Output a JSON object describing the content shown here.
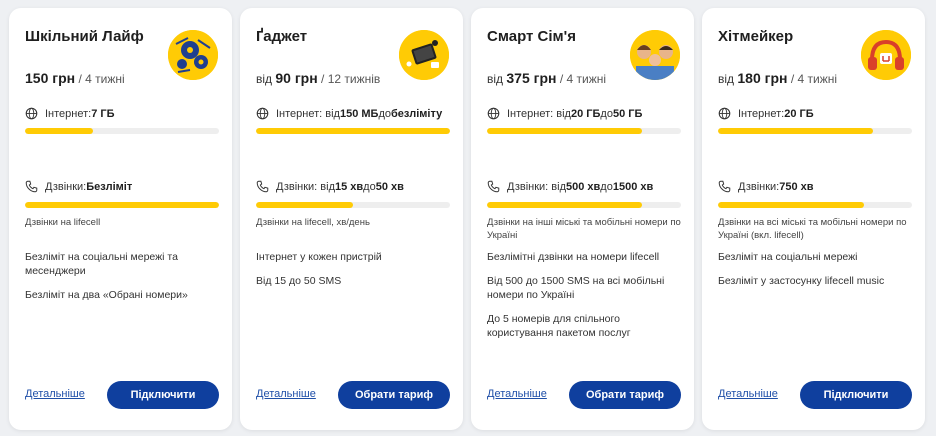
{
  "accent": "#ffcb05",
  "button_color": "#0f3f9e",
  "cards": [
    {
      "title": "Шкільний Лайф",
      "price_prefix": "",
      "price": "150 грн",
      "period": "/ 4 тижні",
      "internet_label": "Інтернет: ",
      "internet_value": "7 ГБ",
      "internet_fill": 0.35,
      "calls_label": "Дзвінки: ",
      "calls_value": "Безліміт",
      "calls_fill": 1.0,
      "calls_note": "Дзвінки на lifecell",
      "features": [
        "Безліміт на соціальні мережі та месенджери",
        "Безліміт на два «Обрані номери»"
      ],
      "details": "Детальніше",
      "action": "Підключити",
      "avatar_icon": "school-life-avatar-icon"
    },
    {
      "title": "Ґаджет",
      "price_prefix": "від ",
      "price": "90 грн",
      "period": "/ 12 тижнів",
      "internet_label": "Інтернет: від ",
      "internet_value": "150 МБ",
      "internet_mid": " до ",
      "internet_value2": "безліміту",
      "internet_fill": 1.0,
      "calls_label": "Дзвінки: від ",
      "calls_value": "15 хв",
      "calls_mid": " до ",
      "calls_value2": "50 хв",
      "calls_fill": 0.5,
      "calls_note": "Дзвінки на lifecell, хв/день",
      "features": [
        "Інтернет у кожен пристрій",
        "Від 15 до 50 SMS"
      ],
      "details": "Детальніше",
      "action": "Обрати тариф",
      "avatar_icon": "gadget-avatar-icon"
    },
    {
      "title": "Смарт Сім'я",
      "price_prefix": "від ",
      "price": "375 грн",
      "period": "/ 4 тижні",
      "internet_label": "Інтернет: від ",
      "internet_value": "20 ГБ",
      "internet_mid": " до ",
      "internet_value2": "50 ГБ",
      "internet_fill": 0.8,
      "calls_label": "Дзвінки: від ",
      "calls_value": "500 хв",
      "calls_mid": " до ",
      "calls_value2": "1500 хв",
      "calls_fill": 0.8,
      "calls_note": "Дзвінки на інші міські та мобільні номери по Україні",
      "features": [
        "Безлімітні дзвінки на номери lifecell",
        "Від 500 до 1500 SMS на всі мобільні номери по Україні",
        "До 5 номерів для спільного користування пакетом послуг"
      ],
      "details": "Детальніше",
      "action": "Обрати тариф",
      "avatar_icon": "family-avatar-icon"
    },
    {
      "title": "Хітмейкер",
      "price_prefix": "від ",
      "price": "180 грн",
      "period": "/ 4 тижні",
      "internet_label": "Інтернет: ",
      "internet_value": "20 ГБ",
      "internet_fill": 0.8,
      "calls_label": "Дзвінки: ",
      "calls_value": "750 хв",
      "calls_fill": 0.75,
      "calls_note": "Дзвінки на всі міські та мобільні номери по Україні (вкл. lifecell)",
      "features": [
        "Безліміт на соціальні мережі",
        "Безліміт у застосунку lifecell music"
      ],
      "details": "Детальніше",
      "action": "Підключити",
      "avatar_icon": "headphones-avatar-icon"
    }
  ]
}
